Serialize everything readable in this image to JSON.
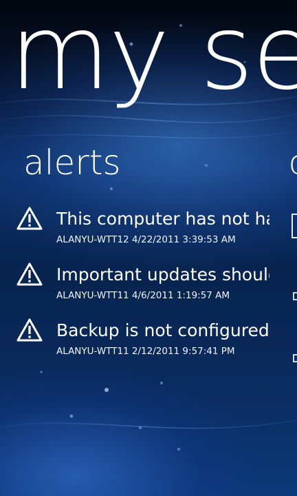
{
  "header": {
    "panorama_title": "my se"
  },
  "alerts_section": {
    "header": "alerts",
    "items": [
      {
        "icon": "warning-triangle-icon",
        "title": "This computer has not ha",
        "meta": "ALANYU-WTT12 4/22/2011 3:39:53 AM"
      },
      {
        "icon": "warning-triangle-icon",
        "title": "Important updates shoulc",
        "meta": "ALANYU-WTT11 4/6/2011 1:19:57 AM"
      },
      {
        "icon": "warning-triangle-icon",
        "title": "Backup is not configured",
        "meta": "ALANYU-WTT11 2/12/2011 9:57:41 PM"
      }
    ]
  },
  "next_section": {
    "header_peek": "c"
  },
  "colors": {
    "background_top": "#02070f",
    "background_mid": "#0c2f66",
    "text": "#ffffff"
  }
}
